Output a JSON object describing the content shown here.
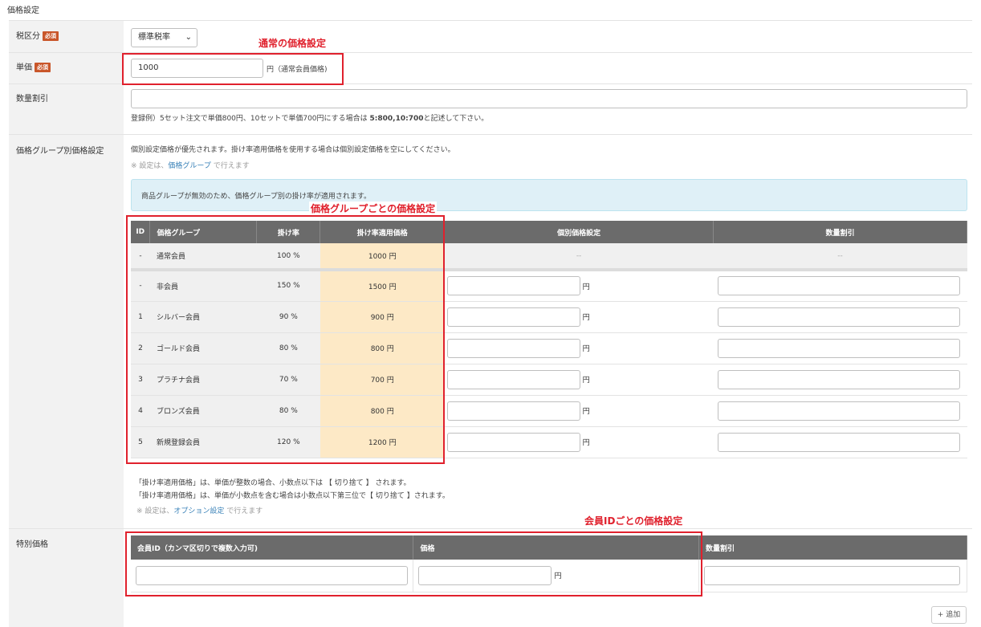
{
  "section_title": "価格設定",
  "required_badge": "必須",
  "tax": {
    "label": "税区分",
    "selected": "標準税率"
  },
  "unit_price": {
    "label": "単価",
    "value": "1000",
    "suffix": "円（通常会員価格)"
  },
  "qty_discount": {
    "label": "数量割引",
    "value": "",
    "example_prefix": "登録例）5セット注文で単価800円、10セットで単価700円にする場合は ",
    "example_bold": "5:800,10:700",
    "example_suffix": "と記述して下さい。"
  },
  "group_pricing": {
    "label": "価格グループ別価格設定",
    "desc": "個別設定価格が優先されます。掛け率適用価格を使用する場合は個別設定価格を空にしてください。",
    "note_prefix": "※ 設定は、",
    "note_link": "価格グループ",
    "note_suffix": "で行えます",
    "info": "商品グループが無効のため、価格グループ別の掛け率が適用されます。",
    "headers": [
      "ID",
      "価格グループ",
      "掛け率",
      "掛け率適用価格",
      "個別価格設定",
      "数量割引"
    ],
    "normal_row": {
      "id": "-",
      "name": "通常会員",
      "rate": "100 %",
      "price": "1000 円",
      "individual": "--",
      "qty": "--"
    },
    "rows": [
      {
        "id": "-",
        "name": "非会員",
        "rate": "150 %",
        "price": "1500 円"
      },
      {
        "id": "1",
        "name": "シルバー会員",
        "rate": "90 %",
        "price": "900 円"
      },
      {
        "id": "2",
        "name": "ゴールド会員",
        "rate": "80 %",
        "price": "800 円"
      },
      {
        "id": "3",
        "name": "プラチナ会員",
        "rate": "70 %",
        "price": "700 円"
      },
      {
        "id": "4",
        "name": "ブロンズ会員",
        "rate": "80 %",
        "price": "800 円"
      },
      {
        "id": "5",
        "name": "新規登録会員",
        "rate": "120 %",
        "price": "1200 円"
      }
    ],
    "yen": "円",
    "footnote1": "「掛け率適用価格」は、単価が整数の場合、小数点以下は 【 切り捨て 】 されます。",
    "footnote2": "「掛け率適用価格」は、単価が小数点を含む場合は小数点以下第三位で【 切り捨て 】されます。",
    "footnote_note_prefix": "※ 設定は、",
    "footnote_note_link": "オプション設定",
    "footnote_note_suffix": "で行えます"
  },
  "special_price": {
    "label": "特別価格",
    "headers": [
      "会員ID（カンマ区切りで複数入力可)",
      "価格",
      "数量割引"
    ],
    "yen": "円",
    "add_button": "+ 追加"
  },
  "annotations": {
    "normal_price": "通常の価格設定",
    "group_price": "価格グループごとの価格設定",
    "member_price": "会員IDごとの価格設定"
  },
  "colors": {
    "annotation_red": "#e0212d",
    "header_gray": "#6b6b6b",
    "rate_price_yellow": "#fde9c6",
    "info_blue": "#dff0f7",
    "required_badge": "#c9562a",
    "link_blue": "#3a82b8"
  }
}
